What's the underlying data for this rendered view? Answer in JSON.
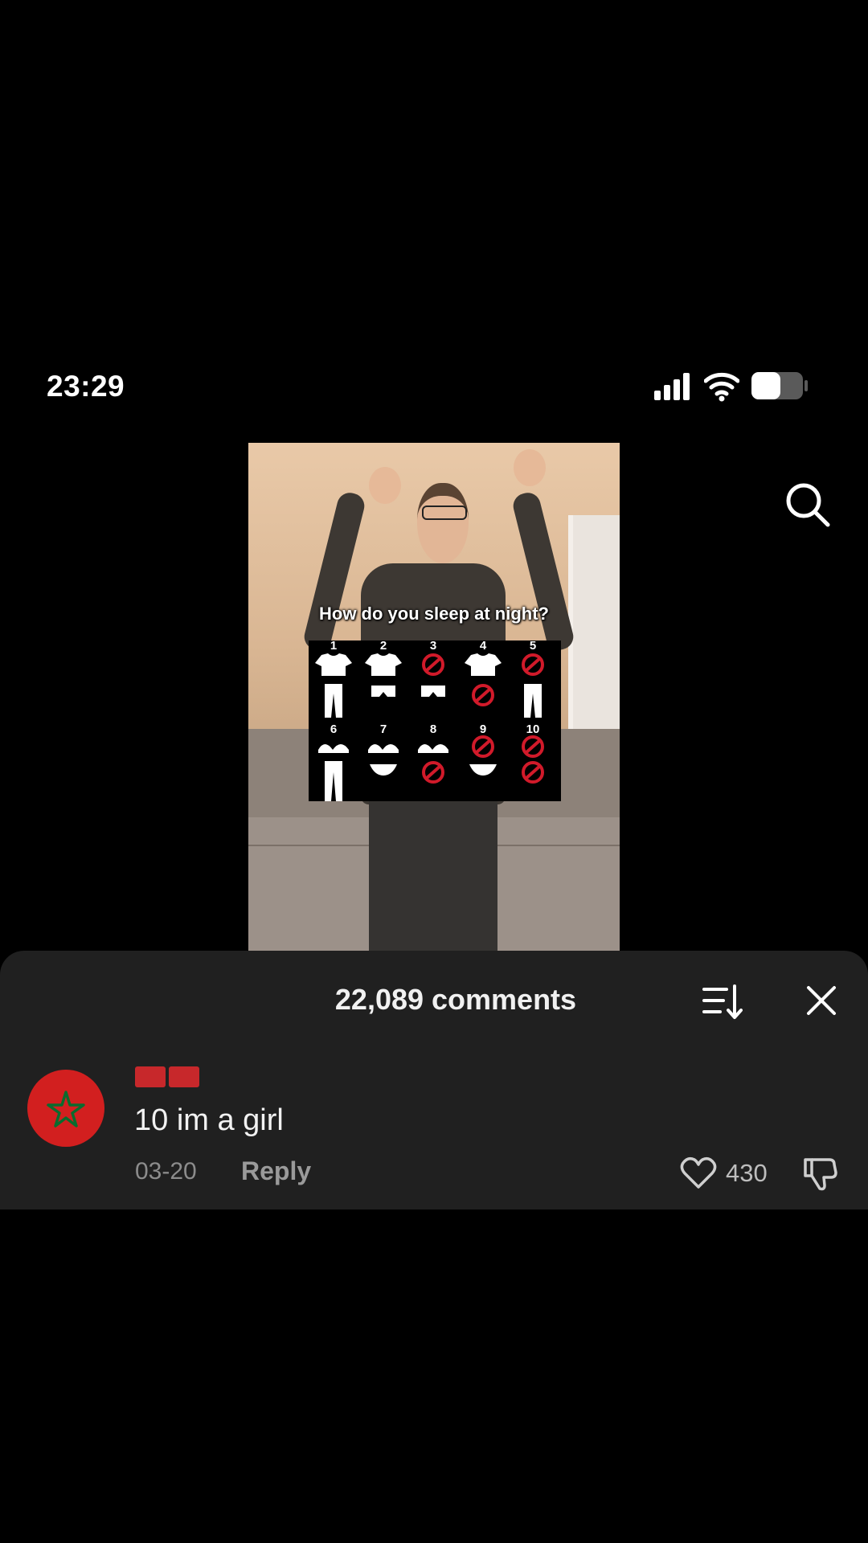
{
  "status_bar": {
    "time": "23:29",
    "signal_icon": "cellular-signal-icon",
    "wifi_icon": "wifi-icon",
    "battery_icon": "battery-icon"
  },
  "video": {
    "caption": "How do you sleep at night?",
    "options": [
      "1",
      "2",
      "3",
      "4",
      "5",
      "6",
      "7",
      "8",
      "9",
      "10"
    ]
  },
  "search": {
    "icon": "search-icon"
  },
  "comments": {
    "title": "22,089 comments",
    "sort_icon": "sort-icon",
    "close_icon": "close-icon",
    "items": [
      {
        "avatar_icon": "morocco-flag-icon",
        "text": "10 im a girl",
        "date": "03-20",
        "reply_label": "Reply",
        "likes": "430"
      }
    ]
  },
  "colors": {
    "background": "#000000",
    "sheet": "#202020",
    "avatar": "#d21f1f"
  }
}
